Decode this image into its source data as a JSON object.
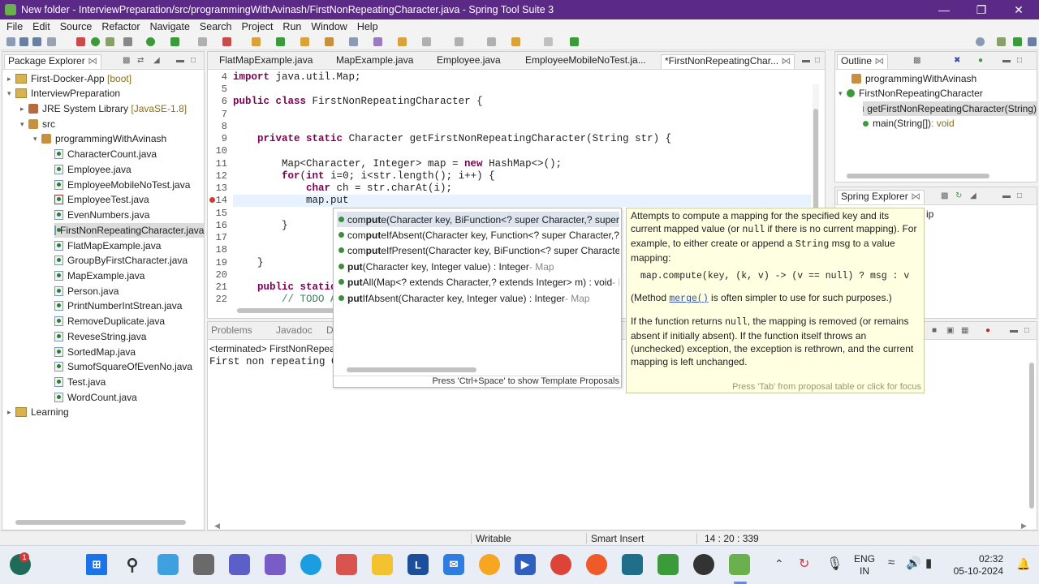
{
  "window": {
    "title": "New folder - InterviewPreparation/src/programmingWithAvinash/FirstNonRepeatingCharacter.java - Spring Tool Suite 3"
  },
  "menu": [
    "File",
    "Edit",
    "Source",
    "Refactor",
    "Navigate",
    "Search",
    "Project",
    "Run",
    "Window",
    "Help"
  ],
  "package_explorer": {
    "title": "Package Explorer",
    "items": [
      {
        "label": "First-Docker-App",
        "suffix": "[boot]"
      },
      {
        "label": "InterviewPreparation"
      },
      {
        "label": "JRE System Library",
        "suffix": "[JavaSE-1.8]"
      },
      {
        "label": "src"
      },
      {
        "label": "programmingWithAvinash"
      },
      {
        "label": "CharacterCount.java"
      },
      {
        "label": "Employee.java"
      },
      {
        "label": "EmployeeMobileNoTest.java"
      },
      {
        "label": "EmployeeTest.java"
      },
      {
        "label": "EvenNumbers.java"
      },
      {
        "label": "FirstNonRepeatingCharacter.java"
      },
      {
        "label": "FlatMapExample.java"
      },
      {
        "label": "GroupByFirstCharacter.java"
      },
      {
        "label": "MapExample.java"
      },
      {
        "label": "Person.java"
      },
      {
        "label": "PrintNumberIntStrean.java"
      },
      {
        "label": "RemoveDuplicate.java"
      },
      {
        "label": "ReveseString.java"
      },
      {
        "label": "SortedMap.java"
      },
      {
        "label": "SumofSquareOfEvenNo.java"
      },
      {
        "label": "Test.java"
      },
      {
        "label": "WordCount.java"
      },
      {
        "label": "Learning"
      }
    ]
  },
  "editor": {
    "tabs": [
      "FlatMapExample.java",
      "MapExample.java",
      "Employee.java",
      "EmployeeMobileNoTest.ja...",
      "*FirstNonRepeatingChar..."
    ],
    "lines": [
      {
        "n": "4",
        "code": "import java.util.Map;"
      },
      {
        "n": "5",
        "code": ""
      },
      {
        "n": "6",
        "code": "public class FirstNonRepeatingCharacter {"
      },
      {
        "n": "7",
        "code": ""
      },
      {
        "n": "8",
        "code": ""
      },
      {
        "n": "9",
        "code": "    private static Character getFirstNonRepeatingCharacter(String str) {"
      },
      {
        "n": "10",
        "code": ""
      },
      {
        "n": "11",
        "code": "        Map<Character, Integer> map = new HashMap<>();"
      },
      {
        "n": "12",
        "code": "        for(int i=0; i<str.length(); i++) {"
      },
      {
        "n": "13",
        "code": "            char ch = str.charAt(i);"
      },
      {
        "n": "14",
        "code": "            map.put"
      },
      {
        "n": "15",
        "code": ""
      },
      {
        "n": "16",
        "code": "        }"
      },
      {
        "n": "17",
        "code": ""
      },
      {
        "n": "18",
        "code": ""
      },
      {
        "n": "19",
        "code": "    }"
      },
      {
        "n": "20",
        "code": ""
      },
      {
        "n": "21",
        "code": "    public static"
      },
      {
        "n": "22",
        "code": "        // TODO A"
      }
    ]
  },
  "completion": {
    "proposals": [
      {
        "pre": "com",
        "match": "put",
        "post": "e(Character key, BiFunction<? super Character,? super Int"
      },
      {
        "pre": "com",
        "match": "put",
        "post": "eIfAbsent(Character key, Function<? super Character,? ex"
      },
      {
        "pre": "com",
        "match": "put",
        "post": "eIfPresent(Character key, BiFunction<? super Character,?"
      },
      {
        "pre": "",
        "match": "put",
        "post": "(Character key, Integer value) : Integer",
        "dim": " - Map"
      },
      {
        "pre": "",
        "match": "put",
        "post": "All(Map<? extends Character,? extends Integer> m) : void",
        "dim": " - M"
      },
      {
        "pre": "",
        "match": "put",
        "post": "IfAbsent(Character key, Integer value) : Integer",
        "dim": " - Map"
      }
    ],
    "footer": "Press 'Ctrl+Space' to show Template Proposals"
  },
  "javadoc": {
    "p1": "Attempts to compute a mapping for the specified key and its current mapped value (or",
    "p1_null": "null",
    "p1b": "if there is no current mapping). For example, to either create or append a",
    "p1_string": "String",
    "p1c": "msg to a value mapping:",
    "code": "map.compute(key, (k, v) -> (v == null) ? msg : v",
    "p2a": "(Method",
    "p2_link": "merge()",
    "p2b": "is often simpler to use for such purposes.)",
    "p3a": "If the function returns",
    "p3_null": "null",
    "p3b": ", the mapping is removed (or remains absent if initially absent). If the function itself throws an (unchecked) exception, the exception is rethrown, and the current mapping is left unchanged.",
    "footer": "Press 'Tab' from proposal table or click for focus"
  },
  "outline": {
    "title": "Outline",
    "items": [
      "programmingWithAvinash",
      "FirstNonRepeatingCharacter",
      "getFirstNonRepeatingCharacter(String)"
    ],
    "main_label": "main(String[])",
    "main_type": " : void"
  },
  "spring_explorer": {
    "title": "Spring Explorer",
    "partial": "ip"
  },
  "console": {
    "tabs": [
      "Problems",
      "Javadoc",
      "D"
    ],
    "terminated": "<terminated> FirstNonRepea",
    "output": "First non repeating C"
  },
  "status": {
    "writable": "Writable",
    "insert": "Smart Insert",
    "position": "14 : 20 : 339"
  },
  "taskbar": {
    "lang1": "ENG",
    "lang2": "IN",
    "time": "02:32",
    "date": "05-10-2024",
    "badge": "1"
  },
  "colors": {
    "titlebar": "#5a2a86",
    "keyword": "#7f0055",
    "comment": "#3f7f5f",
    "javadoc_bg": "#ffffe1"
  }
}
